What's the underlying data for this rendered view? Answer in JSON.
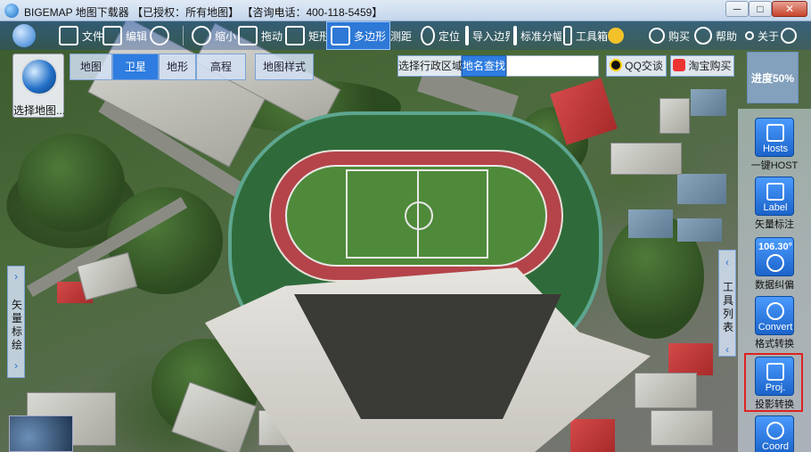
{
  "window": {
    "title": "BIGEMAP 地图下载器 【已授权：所有地图】 【咨询电话：400-118-5459】",
    "min_label": "─",
    "max_label": "□",
    "close_label": "✕"
  },
  "toolbar": {
    "items": [
      {
        "label": "文件",
        "icon": "folder-icon"
      },
      {
        "label": "编辑",
        "icon": "edit-icon"
      },
      {
        "label": "",
        "icon": "settings-icon"
      },
      {
        "label": "缩小",
        "icon": "zoom-out-icon"
      },
      {
        "label": "拖动",
        "icon": "hand-icon"
      },
      {
        "label": "矩形",
        "icon": "rectangle-icon"
      },
      {
        "label": "多边形",
        "icon": "polygon-icon"
      },
      {
        "label": "测距",
        "icon": "ruler-icon"
      },
      {
        "label": "定位",
        "icon": "location-pin-icon"
      },
      {
        "label": "导入边界",
        "icon": "import-icon"
      },
      {
        "label": "标准分幅",
        "icon": "grid-icon"
      },
      {
        "label": "工具箱",
        "icon": "toolbox-icon"
      },
      {
        "label": "",
        "icon": "vip-icon"
      },
      {
        "label": "购买",
        "icon": "cart-icon"
      },
      {
        "label": "帮助",
        "icon": "help-icon"
      },
      {
        "label": "关于",
        "icon": "about-icon"
      }
    ]
  },
  "map_selector": {
    "label": "选择地图..."
  },
  "map_types": [
    {
      "label": "地图",
      "active": false
    },
    {
      "label": "卫星",
      "active": true
    },
    {
      "label": "地形",
      "active": false
    },
    {
      "label": "高程",
      "active": false
    }
  ],
  "map_style_label": "地图样式",
  "search": {
    "region_label": "选择行政区域",
    "place_label": "地名查找",
    "input_value": ""
  },
  "contact": {
    "qq_label": "QQ交谈",
    "taobao_label": "淘宝购买"
  },
  "progress_label": "进度50%",
  "tools": [
    {
      "en": "Hosts",
      "caption": "一键HOST",
      "icon": "hosts-icon"
    },
    {
      "en": "Label",
      "caption": "矢量标注",
      "icon": "label-icon"
    },
    {
      "en": "106.30°",
      "caption": "数据纠偏",
      "icon": "globe-correct-icon"
    },
    {
      "en": "Convert",
      "caption": "格式转换",
      "icon": "convert-icon"
    },
    {
      "en": "Proj.",
      "caption": "投影转换",
      "icon": "projection-icon"
    },
    {
      "en": "Coord",
      "caption": "",
      "icon": "coord-icon"
    }
  ],
  "side_tabs": {
    "vector_label": "矢量标绘",
    "tool_label": "工具列表",
    "arrow_left": "‹",
    "arrow_right": "›"
  }
}
